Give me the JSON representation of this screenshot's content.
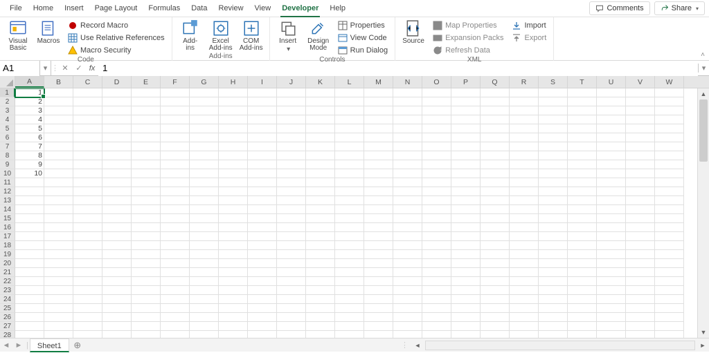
{
  "tabs": [
    "File",
    "Home",
    "Insert",
    "Page Layout",
    "Formulas",
    "Data",
    "Review",
    "View",
    "Developer",
    "Help"
  ],
  "active_tab": "Developer",
  "comments_btn": "Comments",
  "share_btn": "Share",
  "ribbon": {
    "code": {
      "visual_basic": "Visual\nBasic",
      "macros": "Macros",
      "record": "Record Macro",
      "userel": "Use Relative References",
      "security": "Macro Security",
      "label": "Code"
    },
    "addins": {
      "addins": "Add-\nins",
      "excel": "Excel\nAdd-ins",
      "com": "COM\nAdd-ins",
      "label": "Add-ins"
    },
    "controls": {
      "insert": "Insert",
      "design": "Design\nMode",
      "properties": "Properties",
      "viewcode": "View Code",
      "rundialog": "Run Dialog",
      "label": "Controls"
    },
    "xml": {
      "source": "Source",
      "map": "Map Properties",
      "expansion": "Expansion Packs",
      "refresh": "Refresh Data",
      "import": "Import",
      "export": "Export",
      "label": "XML"
    }
  },
  "namebox": "A1",
  "formula_value": "1",
  "columns": [
    "A",
    "B",
    "C",
    "D",
    "E",
    "F",
    "G",
    "H",
    "I",
    "J",
    "K",
    "L",
    "M",
    "N",
    "O",
    "P",
    "Q",
    "R",
    "S",
    "T",
    "U",
    "V",
    "W"
  ],
  "row_count": 28,
  "selected_cell": {
    "row": 1,
    "col": "A"
  },
  "cell_data": {
    "A1": "1",
    "A2": "2",
    "A3": "3",
    "A4": "4",
    "A5": "5",
    "A6": "6",
    "A7": "7",
    "A8": "8",
    "A9": "9",
    "A10": "10"
  },
  "sheet": "Sheet1"
}
